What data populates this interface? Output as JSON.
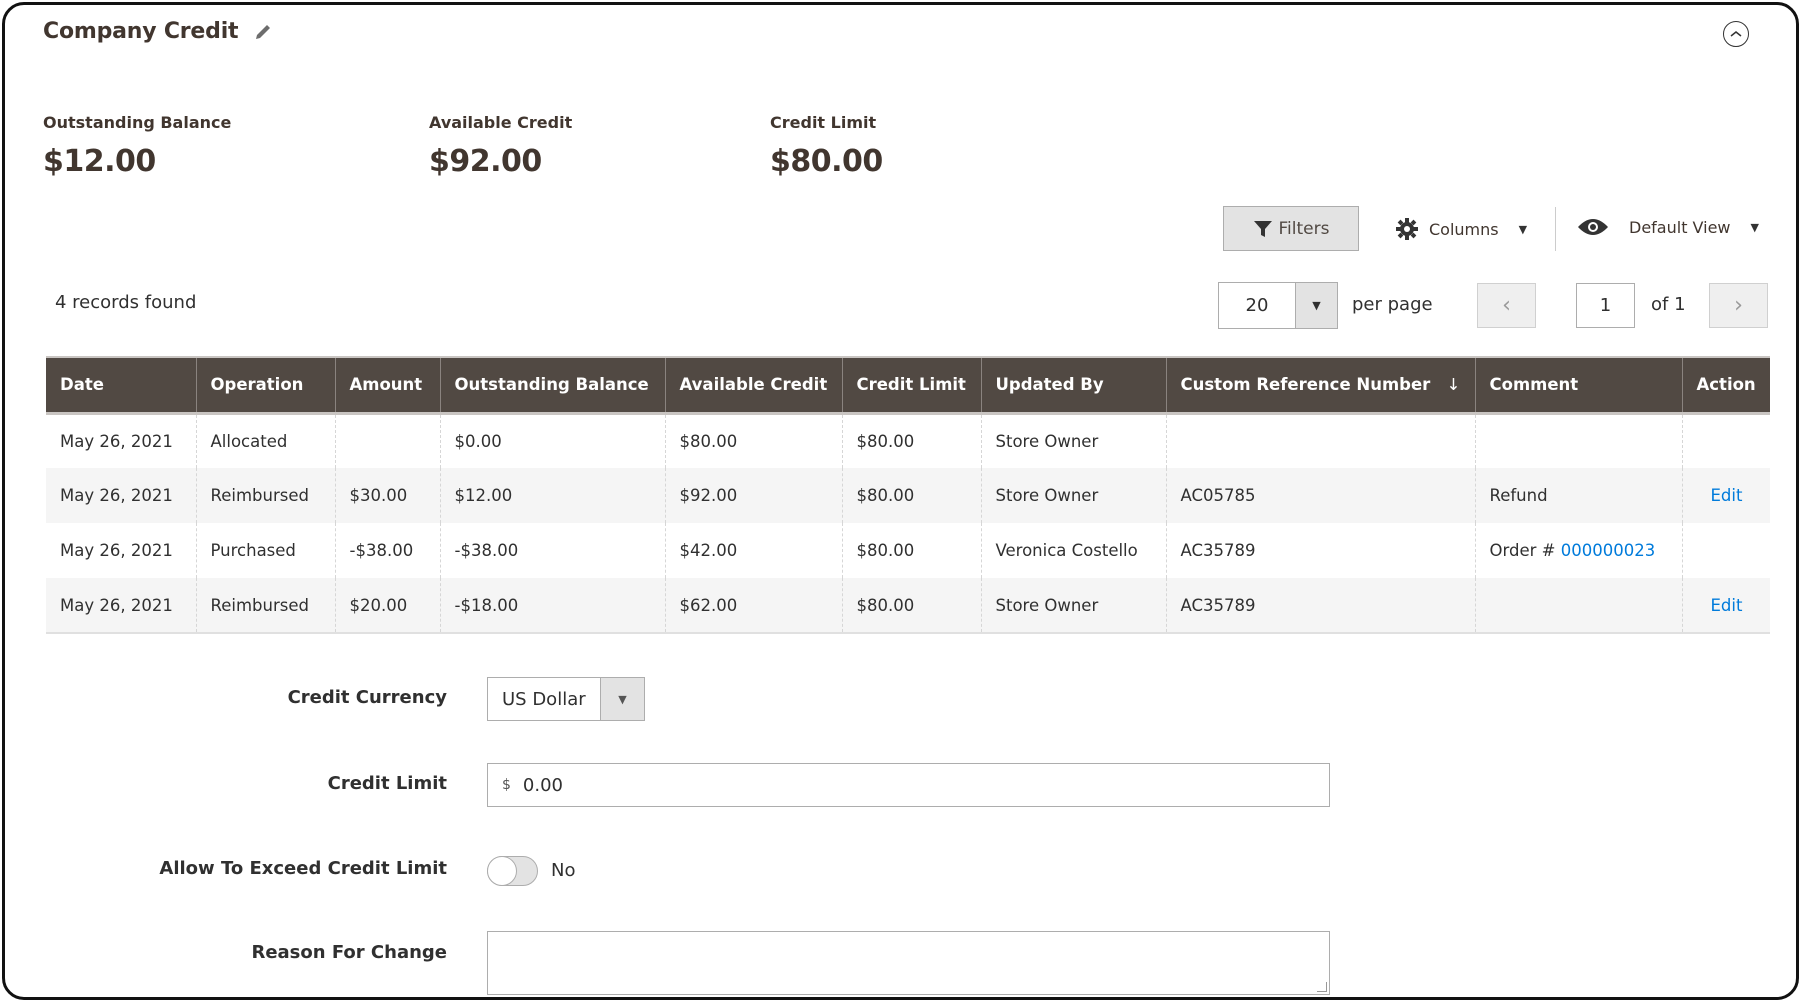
{
  "header": {
    "title": "Company Credit",
    "edit_icon": "pencil-icon",
    "collapse_icon": "chevron-up-circle-icon"
  },
  "summary": [
    {
      "label": "Outstanding Balance",
      "value": "$12.00"
    },
    {
      "label": "Available Credit",
      "value": "$92.00"
    },
    {
      "label": "Credit Limit",
      "value": "$80.00"
    }
  ],
  "toolbar": {
    "filters_label": "Filters",
    "columns_label": "Columns",
    "view_label": "Default View"
  },
  "grid": {
    "records_found": "4 records found",
    "per_page_value": "20",
    "per_page_label": "per page",
    "page_current": "1",
    "page_of": "of 1",
    "columns": [
      "Date",
      "Operation",
      "Amount",
      "Outstanding Balance",
      "Available Credit",
      "Credit Limit",
      "Updated By",
      "Custom Reference Number",
      "Comment",
      "Action"
    ],
    "sort_indicator": "↓",
    "rows": [
      {
        "date": "May 26, 2021",
        "operation": "Allocated",
        "amount": "",
        "outstanding": "$0.00",
        "available": "$80.00",
        "limit": "$80.00",
        "updated_by": "Store Owner",
        "ref": "",
        "comment": "",
        "comment_link": "",
        "action": ""
      },
      {
        "date": "May 26, 2021",
        "operation": "Reimbursed",
        "amount": "$30.00",
        "outstanding": "$12.00",
        "available": "$92.00",
        "limit": "$80.00",
        "updated_by": "Store Owner",
        "ref": "AC05785",
        "comment": "Refund",
        "comment_link": "",
        "action": "Edit"
      },
      {
        "date": "May 26, 2021",
        "operation": "Purchased",
        "amount": "-$38.00",
        "outstanding": "-$38.00",
        "available": "$42.00",
        "limit": "$80.00",
        "updated_by": "Veronica Costello",
        "ref": "AC35789",
        "comment": "Order # ",
        "comment_link": "000000023",
        "action": ""
      },
      {
        "date": "May 26, 2021",
        "operation": "Reimbursed",
        "amount": "$20.00",
        "outstanding": "-$18.00",
        "available": "$62.00",
        "limit": "$80.00",
        "updated_by": "Store Owner",
        "ref": "AC35789",
        "comment": "",
        "comment_link": "",
        "action": "Edit"
      }
    ]
  },
  "form": {
    "currency_label": "Credit Currency",
    "currency_value": "US Dollar",
    "limit_label": "Credit Limit",
    "limit_currency_symbol": "$",
    "limit_value": "0.00",
    "exceed_label": "Allow To Exceed Credit Limit",
    "exceed_value": "No",
    "exceed_enabled": false,
    "reason_label": "Reason For Change",
    "reason_value": ""
  },
  "colors": {
    "header_bg": "#514943",
    "link": "#007bdb",
    "text": "#303030"
  }
}
